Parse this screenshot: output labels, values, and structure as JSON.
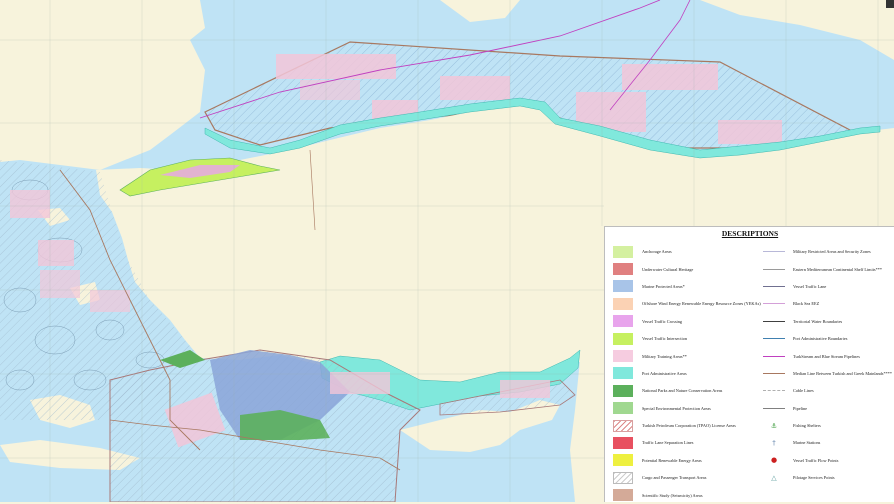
{
  "legend": {
    "title": "DESCRIPTIONS",
    "left_items": [
      {
        "label": "Anchorage Areas",
        "color": "#d4f0a0",
        "style": "fill"
      },
      {
        "label": "Underwater Cultural Heritage",
        "color": "#e08080",
        "style": "fill"
      },
      {
        "label": "Marine Protected Areas*",
        "color": "#a8c4e8",
        "style": "fill"
      },
      {
        "label": "Offshore Wind Energy Renewable Energy Resource Zones (YEKAs)",
        "color": "#fbd2b4",
        "style": "fill"
      },
      {
        "label": "Vessel Traffic Crossing",
        "color": "#e8a4ec",
        "style": "fill"
      },
      {
        "label": "Vessel Traffic Intersection",
        "color": "#c6f060",
        "style": "fill"
      },
      {
        "label": "Military Training Areas**",
        "color": "#f6cce0",
        "style": "fill"
      },
      {
        "label": "Port Administrative Areas",
        "color": "#80e8dc",
        "style": "fill"
      },
      {
        "label": "National Parks and Nature Conservation Areas",
        "color": "#5cb05c",
        "style": "fill"
      },
      {
        "label": "Special Environmental Protection Areas",
        "color": "#a0d890",
        "style": "fill"
      },
      {
        "label": "Turkish Petroleum Corporation (TPAO) License Areas",
        "color": "#d88888",
        "style": "hatch"
      },
      {
        "label": "Traffic Lane Separation Lines",
        "color": "#e85060",
        "style": "fill"
      },
      {
        "label": "Potential Renewable Energy Areas",
        "color": "#eef040",
        "style": "fill"
      },
      {
        "label": "Cargo and Passenger Transport Areas",
        "color": "#cccccc",
        "style": "hatch2"
      },
      {
        "label": "Scientific Study (Seismicity) Areas",
        "color": "#d4aa98",
        "style": "fill"
      }
    ],
    "right_items": [
      {
        "label": "Military Restricted Areas and Security Zones",
        "color": "#b8b8d8",
        "style": "line"
      },
      {
        "label": "Eastern Mediterranean Continental Shelf Limits***",
        "color": "#9a9a9a",
        "style": "line"
      },
      {
        "label": "Vessel Traffic Lane",
        "color": "#707090",
        "style": "line"
      },
      {
        "label": "Black Sea EEZ",
        "color": "#d4a0d8",
        "style": "line"
      },
      {
        "label": "Territorial Water Boundaries",
        "color": "#404040",
        "style": "line"
      },
      {
        "label": "Port Administrative Boundaries",
        "color": "#4080b0",
        "style": "line"
      },
      {
        "label": "TurkStream and Blue Stream Pipelines",
        "color": "#c040c0",
        "style": "line"
      },
      {
        "label": "Median Line Between Turkish and Greek Mainlands****",
        "color": "#a87860",
        "style": "line"
      },
      {
        "label": "Cable Lines",
        "color": "#b0b0b0",
        "style": "dashed"
      },
      {
        "label": "Pipeline",
        "color": "#808080",
        "style": "line"
      },
      {
        "label": "Fishing Shelters",
        "color": "#3a9a3a",
        "style": "symbol",
        "icon": "fishing-shelter-icon"
      },
      {
        "label": "Marine Stations",
        "color": "#6a8ab0",
        "style": "symbol",
        "icon": "marine-station-icon"
      },
      {
        "label": "Vessel Traffic Flow Points",
        "color": "#cc2020",
        "style": "dot",
        "icon": "flow-point-icon"
      },
      {
        "label": "Pilotage Services Points",
        "color": "#60a0a0",
        "style": "symbol",
        "icon": "pilotage-icon"
      }
    ]
  },
  "colors": {
    "sea": "#bfe3f5",
    "land": "#f7f3dc",
    "port_area": "#80e8dc",
    "military_training": "#f2c6d8",
    "tpao_license": "#a87878",
    "national_park": "#5cb05c",
    "marine_protected": "#a8c4e8",
    "pipeline": "#c040c0",
    "eez_boundary": "#a87860"
  }
}
